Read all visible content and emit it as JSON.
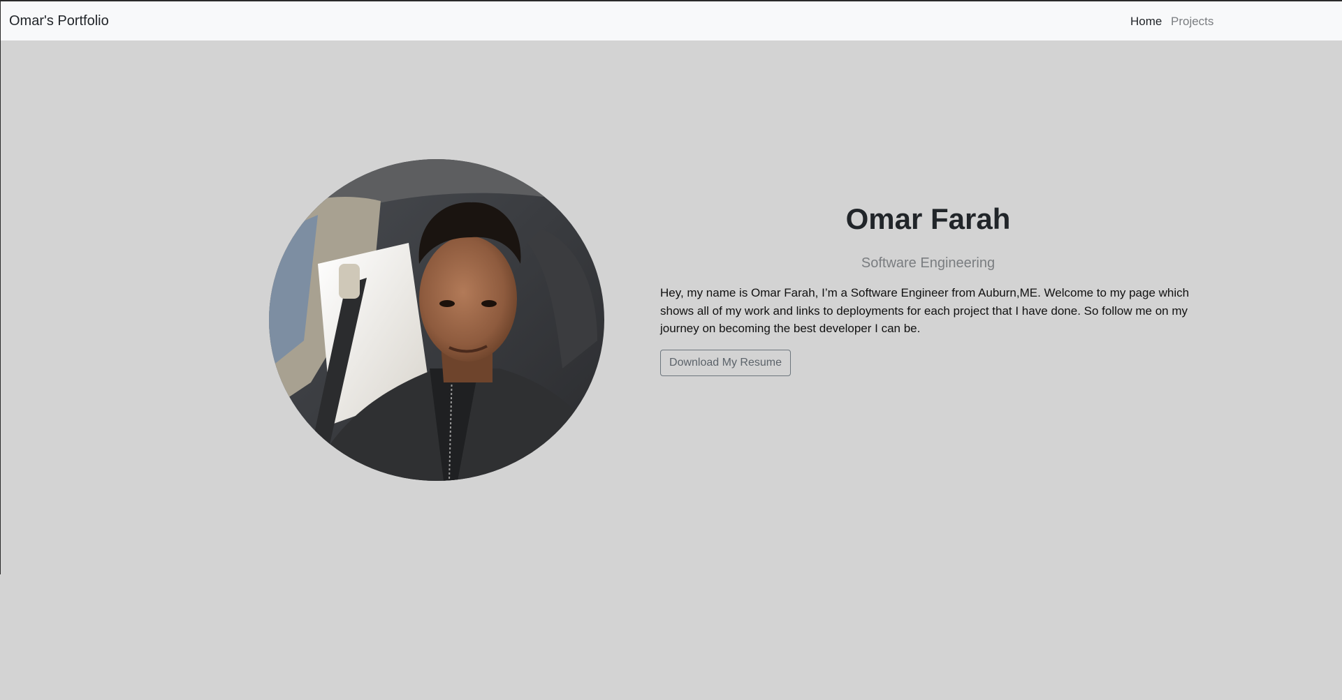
{
  "navbar": {
    "brand": "Omar's Portfolio",
    "links": [
      {
        "label": "Home",
        "active": true
      },
      {
        "label": "Projects",
        "active": false
      }
    ]
  },
  "hero": {
    "name": "Omar Farah",
    "subtitle": "Software Engineering",
    "bio": "Hey, my name is Omar Farah, I’m a Software Engineer from Auburn,ME. Welcome to my page which shows all of my work and links to deployments for each project that I have done. So follow me on my journey on becoming the best developer I can be.",
    "resume_button": "Download My Resume"
  },
  "colors": {
    "page_background": "#d3d3d3",
    "navbar_background": "#f8f9fa",
    "text_dark": "#212529",
    "text_muted": "#7a7d80",
    "button_border": "#6c757d"
  }
}
